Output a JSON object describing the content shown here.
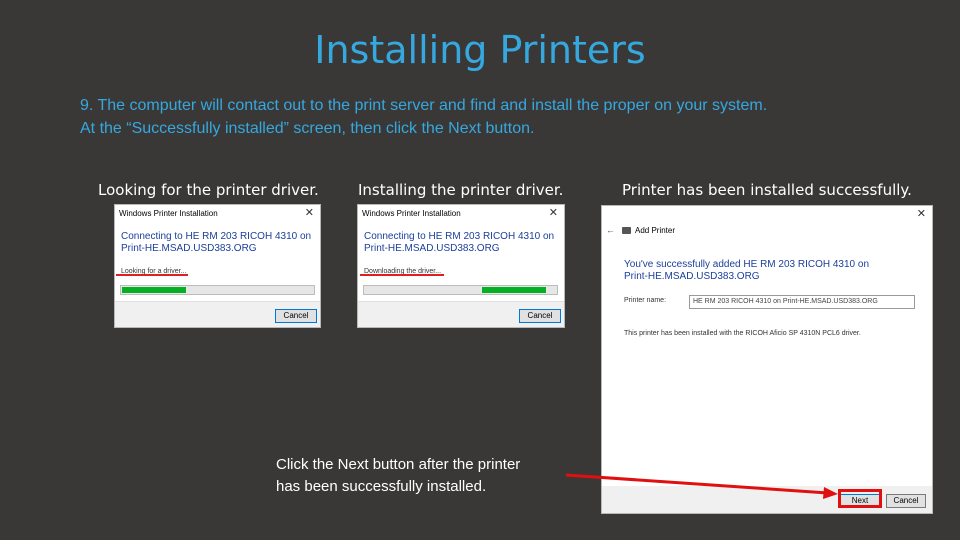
{
  "slide": {
    "title": "Installing Printers",
    "instruction_line1": "9. The computer will contact out to the print server and find and install the proper on your system.",
    "instruction_line2": "At the “Successfully installed” screen, then click the Next button.",
    "note_line1": "Click the Next button after the printer",
    "note_line2": "has been successfully installed."
  },
  "captions": {
    "looking": "Looking for the printer driver.",
    "installing": "Installing the printer driver.",
    "installed": "Printer has been installed successfully."
  },
  "dialog1": {
    "title": "Windows Printer Installation",
    "close": "✕",
    "connecting": "Connecting to HE RM 203 RICOH 4310 on Print-HE.MSAD.USD383.ORG",
    "status": "Looking for a driver...",
    "progress": 0.33,
    "cancel": "Cancel"
  },
  "dialog2": {
    "title": "Windows Printer Installation",
    "close": "✕",
    "connecting": "Connecting to HE RM 203 RICOH 4310 on Print-HE.MSAD.USD383.ORG",
    "status": "Downloading the driver...",
    "progress": 0.33,
    "cancel": "Cancel"
  },
  "add_printer": {
    "close": "✕",
    "back": "←",
    "heading": "Add Printer",
    "message": "You've successfully added HE RM 203 RICOH 4310 on Print-HE.MSAD.USD383.ORG",
    "printer_name_label": "Printer name:",
    "printer_name_value": "HE RM 203 RICOH 4310 on Print-HE.MSAD.USD383.ORG",
    "driver_text": "This printer has been installed with the RICOH Aficio SP 4310N PCL6 driver.",
    "next": "Next",
    "cancel": "Cancel"
  },
  "colors": {
    "background": "#3a3836",
    "title": "#35a8e0",
    "progress": "#06b025",
    "highlight": "#e01010"
  }
}
